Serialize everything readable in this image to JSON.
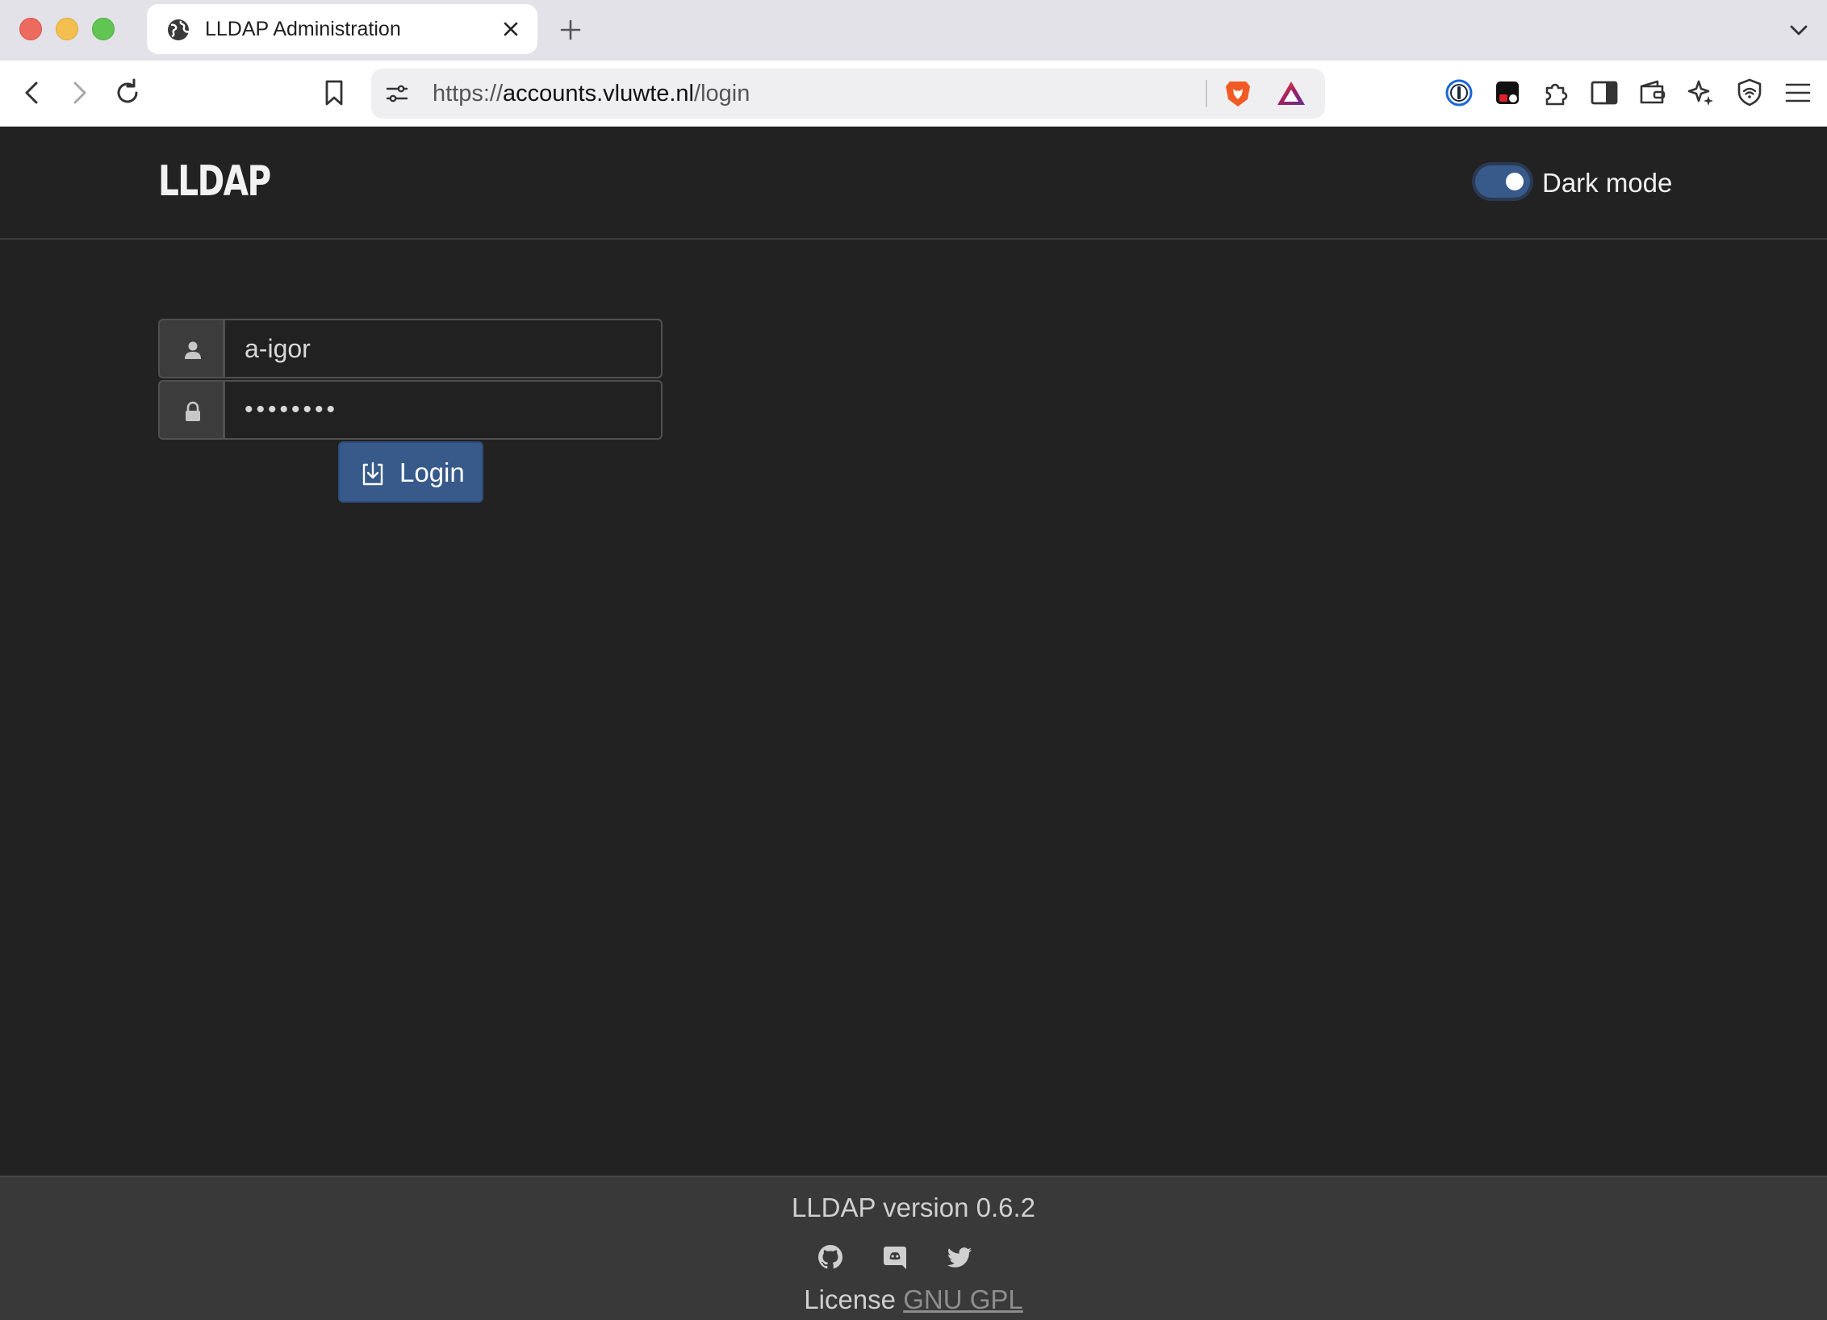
{
  "browser": {
    "tab_title": "LLDAP Administration",
    "url": {
      "protocol": "https://",
      "host": "accounts.vluwte.nl",
      "path": "/login"
    },
    "icons": {
      "tab_favicon": "globe-icon",
      "tab_close": "close-icon",
      "new_tab": "plus-icon",
      "tab_list": "chevron-down-icon",
      "back": "back-arrow-icon",
      "forward": "forward-arrow-icon",
      "reload": "reload-icon",
      "bookmark": "bookmark-icon",
      "site_settings": "tune-icon",
      "brave_shields": "brave-lion-icon",
      "brave_rewards": "rewards-triangle-icon",
      "extensions": [
        "password-manager-icon",
        "extension-icon",
        "puzzle-icon",
        "sidebar-icon",
        "wallet-icon",
        "leo-ai-icon",
        "vpn-shield-icon",
        "menu-icon"
      ]
    }
  },
  "app": {
    "brand": "LLDAP",
    "dark_mode": {
      "label": "Dark mode",
      "enabled": true
    },
    "login_form": {
      "username_value": "a-igor",
      "password_value": "••••••••",
      "submit_label": "Login"
    },
    "footer": {
      "version_text": "LLDAP version 0.6.2",
      "license_prefix": "License ",
      "license_link": "GNU GPL",
      "social_icons": [
        "github-icon",
        "discord-icon",
        "twitter-icon"
      ]
    },
    "colors": {
      "background": "#222222",
      "primary": "#375a8a",
      "footer": "#393939"
    }
  }
}
